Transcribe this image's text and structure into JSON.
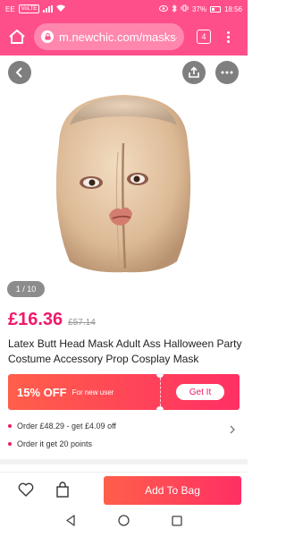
{
  "status_bar": {
    "carrier": "EE",
    "network_badge": "VoLTE",
    "battery": "37%",
    "time": "18:56"
  },
  "browser": {
    "url": "m.newchic.com/masks-",
    "tab_count": "4",
    "accent_color": "#ff4f8b"
  },
  "gallery": {
    "page_indicator": "1 / 10"
  },
  "product": {
    "price": "£16.36",
    "old_price": "£57.14",
    "title": "Latex Butt Head Mask Adult Ass Halloween Party Costume Accessory Prop Cosplay Mask"
  },
  "coupon": {
    "discount": "15% OFF",
    "audience": "For new user",
    "cta": "Get It"
  },
  "offers": [
    "Order £48.29 - get £4.09 off",
    "Order it get 20 points"
  ],
  "bottom_bar": {
    "add_to_bag": "Add To Bag"
  },
  "icons": {
    "home": "home-icon",
    "lock": "lock-icon",
    "back": "arrow-left-icon",
    "share": "share-icon",
    "more": "more-dots-icon",
    "wishlist": "heart-icon",
    "bag": "bag-icon",
    "nav_back": "triangle-back-icon",
    "nav_home": "circle-home-icon",
    "nav_recents": "square-recents-icon"
  }
}
